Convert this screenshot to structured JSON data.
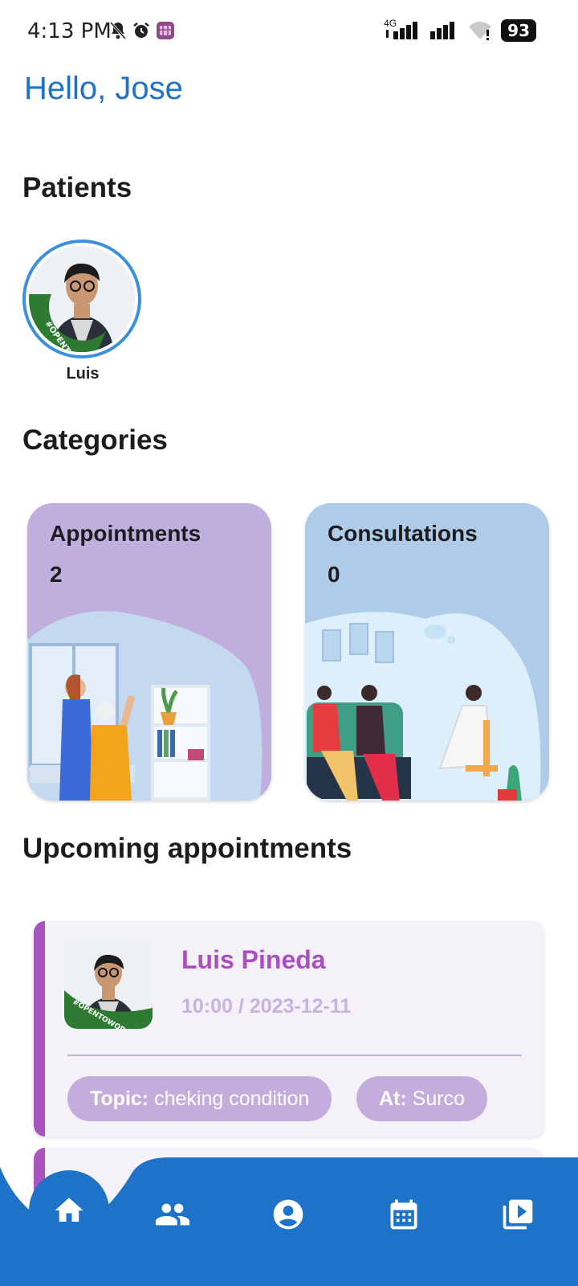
{
  "status_bar": {
    "time": "4:13 PM",
    "network": "4G",
    "battery": "93"
  },
  "greeting": "Hello, Jose",
  "patients": {
    "title": "Patients",
    "items": [
      {
        "name": "Luis",
        "badge_text": "#OPENTOWORK"
      }
    ]
  },
  "categories": {
    "title": "Categories",
    "items": [
      {
        "label": "Appointments",
        "count": "2",
        "color": "#c0aedf"
      },
      {
        "label": "Consultations",
        "count": "0",
        "color": "#aecbe9"
      }
    ]
  },
  "upcoming": {
    "title": "Upcoming appointments",
    "items": [
      {
        "name": "Luis Pineda",
        "when": "10:00 / 2023-12-11",
        "topic_label": "Topic:",
        "topic": "cheking condition",
        "at_label": "At:",
        "at": "Surco"
      }
    ]
  },
  "bottom_nav": {
    "items": [
      "home-icon",
      "people-icon",
      "account-icon",
      "calendar-icon",
      "video-library-icon"
    ],
    "color": "#1e73c8"
  }
}
